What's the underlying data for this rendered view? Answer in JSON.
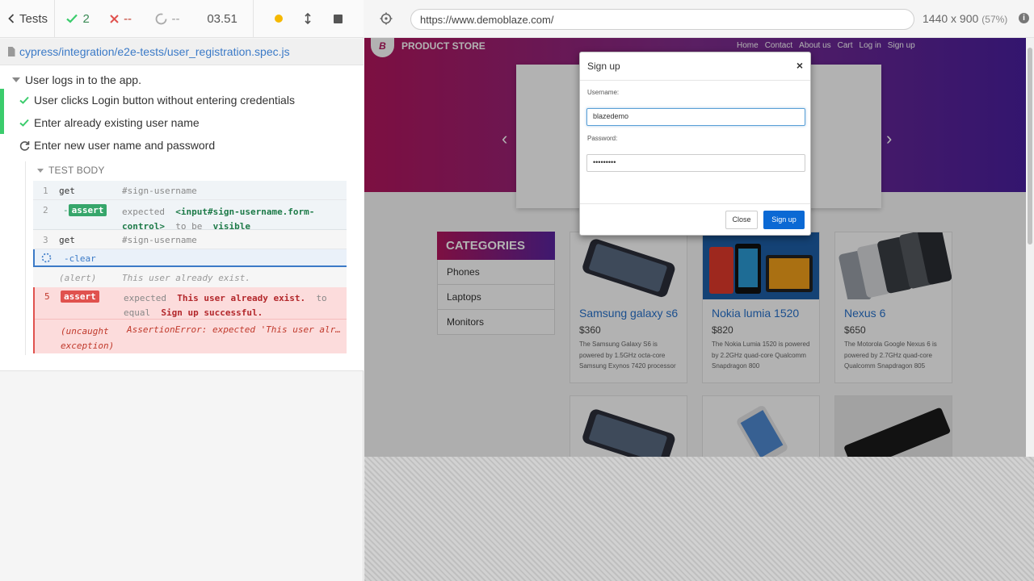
{
  "reporter": {
    "back_label": "Tests",
    "passed": "2",
    "failed": "--",
    "pending": "--",
    "duration": "03.51",
    "spec_path": "cypress/integration/e2e-tests/user_registration.spec.js"
  },
  "suite": {
    "title": "User logs in to the app.",
    "tests": [
      {
        "title": "User clicks Login button without entering credentials",
        "state": "passed"
      },
      {
        "title": "Enter already existing user name",
        "state": "passed"
      },
      {
        "title": "Enter new user name and password",
        "state": "running"
      }
    ]
  },
  "test_body": {
    "label": "TEST BODY",
    "commands": [
      {
        "num": "1",
        "name": "get",
        "message": "#sign-username"
      },
      {
        "num": "2",
        "name": "-assert",
        "badge": "assert",
        "message_parts": [
          "expected",
          "<input#sign-username.form-",
          "control>",
          "to be",
          "visible"
        ]
      },
      {
        "num": "3",
        "name": "get",
        "message": "#sign-username"
      },
      {
        "num": "",
        "name": "-clear",
        "message": ""
      },
      {
        "num": "",
        "name": "(alert)",
        "message": "This user already exist."
      },
      {
        "num": "5",
        "badge": "assert",
        "message_parts": [
          "expected",
          "This user already exist.",
          "to",
          "equal",
          "Sign up successful."
        ]
      },
      {
        "num": "",
        "name": "(uncaught",
        "name2": "exception)",
        "message": "AssertionError: expected 'This user alr…"
      }
    ]
  },
  "aut": {
    "url": "https://www.demoblaze.com/",
    "viewport": "1440 x 900",
    "scale": "(57%)"
  },
  "site": {
    "brand": "PRODUCT STORE",
    "logo_letter": "B",
    "nav": [
      "Home",
      "Contact",
      "About us",
      "Cart",
      "Log in",
      "Sign up"
    ],
    "categories_title": "CATEGORIES",
    "categories": [
      "Phones",
      "Laptops",
      "Monitors"
    ],
    "products": [
      {
        "title": "Samsung galaxy s6",
        "price": "$360",
        "desc": "The Samsung Galaxy S6 is powered by 1.5GHz octa-core Samsung Exynos 7420 processor"
      },
      {
        "title": "Nokia lumia 1520",
        "price": "$820",
        "desc": "The Nokia Lumia 1520 is powered by 2.2GHz quad-core Qualcomm Snapdragon 800"
      },
      {
        "title": "Nexus 6",
        "price": "$650",
        "desc": "The Motorola Google Nexus 6 is powered by 2.7GHz quad-core Qualcomm Snapdragon 805"
      }
    ]
  },
  "modal": {
    "title": "Sign up",
    "close_x": "×",
    "username_label": "Username:",
    "username_value": "blazedemo",
    "password_label": "Password:",
    "password_value": "•••••••••",
    "close_btn": "Close",
    "signup_btn": "Sign up"
  },
  "colors": {
    "pass": "#3bcc6c",
    "fail": "#e0524e",
    "link": "#3b7ac7",
    "brand_gradient_start": "#b3165e",
    "brand_gradient_end": "#4a1f9f",
    "signup_btn": "#0b69d4"
  },
  "icons": [
    "chevron-left-icon",
    "check-icon",
    "x-icon",
    "circle-icon",
    "stop-icon",
    "file-icon",
    "selector-icon",
    "info-icon",
    "refresh-icon"
  ]
}
